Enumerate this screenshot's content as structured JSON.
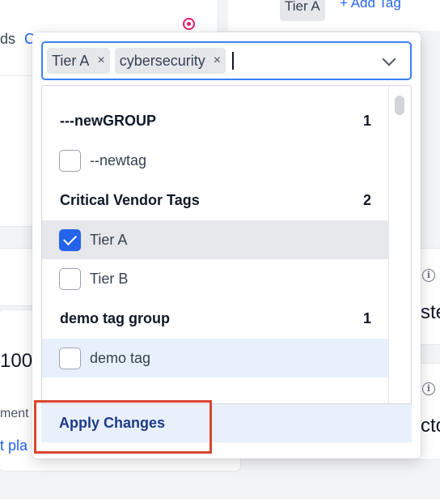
{
  "background": {
    "tier_chip": "Tier A",
    "add_tag": "Add Tag",
    "partial_left_top": "ds",
    "partial_left_link": "C",
    "partial_left_num": "100",
    "partial_left_ment": "ment",
    "partial_left_link2": "t pla",
    "partial_right_1": "ste",
    "partial_right_2": "cto"
  },
  "tag_input": {
    "chips": [
      {
        "label": "Tier A",
        "remove": "×"
      },
      {
        "label": "cybersecurity",
        "remove": "×"
      }
    ]
  },
  "groups": [
    {
      "name": "---newGROUP",
      "count": "1",
      "options": [
        {
          "label": "--newtag",
          "checked": false
        }
      ]
    },
    {
      "name": "Critical Vendor Tags",
      "count": "2",
      "options": [
        {
          "label": "Tier A",
          "checked": true
        },
        {
          "label": "Tier B",
          "checked": false
        }
      ]
    },
    {
      "name": "demo tag group",
      "count": "1",
      "options": [
        {
          "label": "demo tag",
          "checked": false
        }
      ]
    }
  ],
  "footer": {
    "apply_label": "Apply Changes"
  },
  "colors": {
    "accent": "#2563eb",
    "highlight": "#d9452e",
    "hover_bg": "#e8f0fc"
  }
}
